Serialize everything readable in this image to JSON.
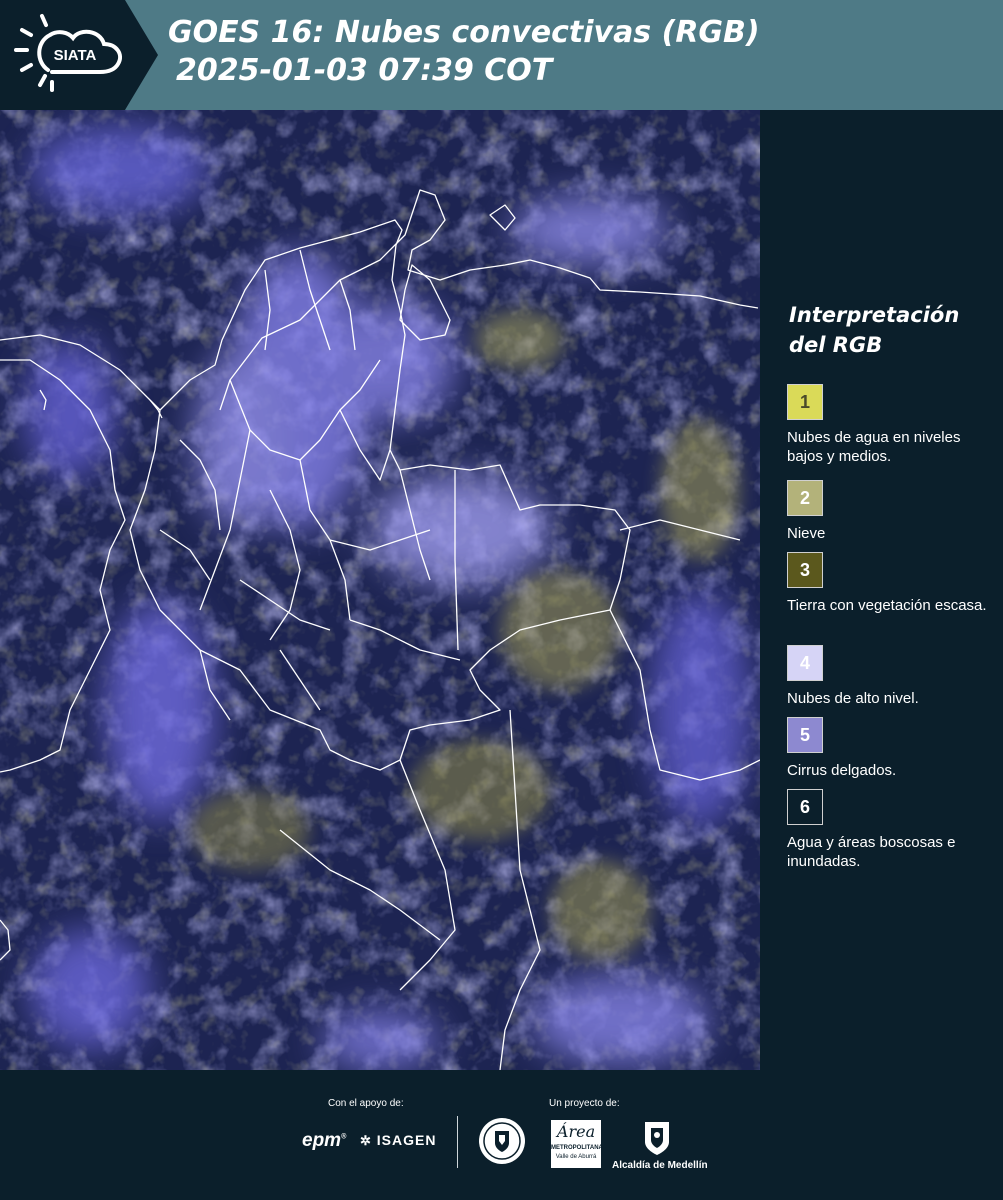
{
  "header": {
    "logo_text": "SIATA",
    "title_line1": "GOES 16: Nubes convectivas (RGB)",
    "title_line2": "2025-01-03 07:39 COT",
    "background_color": "#4e7a86",
    "logo_icon": "sun-cloud-icon"
  },
  "legend": {
    "title_line1": "Interpretación",
    "title_line2": "del RGB",
    "items": [
      {
        "number": "1",
        "label": "Nubes de agua en niveles bajos y medios.",
        "color": "#dada58"
      },
      {
        "number": "2",
        "label": "Nieve",
        "color": "#b3b27a"
      },
      {
        "number": "3",
        "label": "Tierra con vegetación escasa.",
        "color": "#5b581d"
      },
      {
        "number": "4",
        "label": "Nubes de alto nivel.",
        "color": "#d6d4f6"
      },
      {
        "number": "5",
        "label": "Cirrus delgados.",
        "color": "#8d89d0"
      },
      {
        "number": "6",
        "label": "Agua y áreas boscosas e inundadas.",
        "color": "#0b1f2b"
      }
    ]
  },
  "footer": {
    "support_label": "Con el apoyo de:",
    "project_label": "Un proyecto de:",
    "sponsor_epm": "epm",
    "sponsor_isagen": "ISAGEN",
    "partner_metro_line1": "Área",
    "partner_metro_line2": "METROPOLITANA",
    "partner_metro_line3": "Valle de Aburrá",
    "partner_alcaldia": "Alcaldía de Medellín"
  }
}
